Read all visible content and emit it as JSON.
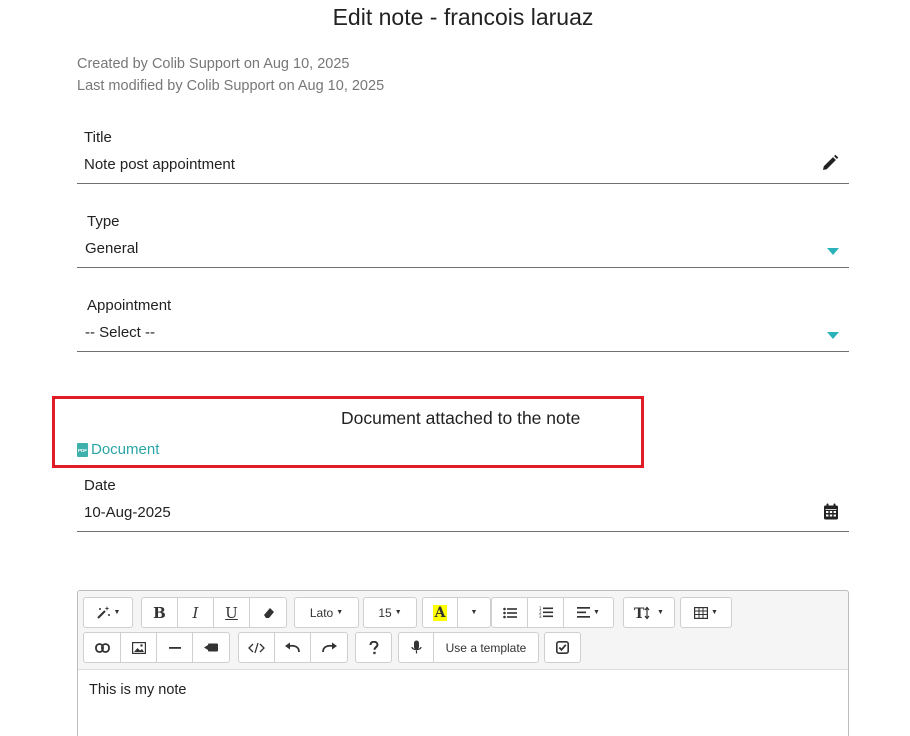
{
  "page": {
    "title": "Edit note - francois laruaz",
    "created": "Created by Colib Support on Aug 10, 2025",
    "modified": "Last modified by Colib Support on Aug 10, 2025"
  },
  "form": {
    "title": {
      "label": "Title",
      "value": "Note post appointment",
      "icon": "pencil-icon"
    },
    "type": {
      "label": "Type",
      "value": "General"
    },
    "appointment": {
      "label": "Appointment",
      "value": "-- Select --"
    },
    "document": {
      "heading": "Document attached to the note",
      "link": "Document",
      "icon": "pdf-file-icon"
    },
    "date": {
      "label": "Date",
      "value": "10-Aug-2025",
      "icon": "calendar-icon"
    }
  },
  "editor": {
    "toolbar": {
      "font_name": "Lato",
      "font_size": "15",
      "template_label": "Use a template",
      "bold": "B",
      "italic": "I",
      "underline": "U",
      "highlight": "A"
    },
    "content": "This is my note"
  },
  "colors": {
    "accent": "#2bb3b9",
    "link": "#2aa5a5",
    "highlight_box": "#e21c27"
  }
}
